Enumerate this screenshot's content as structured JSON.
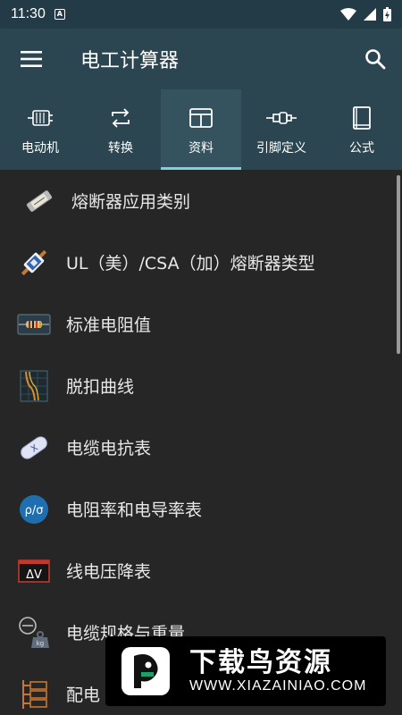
{
  "status_bar": {
    "time": "11:30",
    "notification_badge": "A",
    "icons": [
      "wifi-icon",
      "signal-icon",
      "battery-charging-icon"
    ]
  },
  "app_bar": {
    "title": "电工计算器",
    "menu_icon": "hamburger-menu-icon",
    "search_icon": "search-icon"
  },
  "tabs": [
    {
      "label": "电动机",
      "icon": "motor-icon",
      "active": false
    },
    {
      "label": "转换",
      "icon": "convert-icon",
      "active": false
    },
    {
      "label": "资料",
      "icon": "table-icon",
      "active": true
    },
    {
      "label": "引脚定义",
      "icon": "connector-icon",
      "active": false
    },
    {
      "label": "公式",
      "icon": "book-icon",
      "active": false
    }
  ],
  "list": {
    "items": [
      {
        "label": "熔断器应用类别",
        "icon": "fuse-icon"
      },
      {
        "label": "UL（美）/CSA（加）熔断器类型",
        "icon": "ul-fuse-icon"
      },
      {
        "label": "标准电阻值",
        "icon": "resistor-icon"
      },
      {
        "label": "脱扣曲线",
        "icon": "trip-curve-icon"
      },
      {
        "label": "电缆电抗表",
        "icon": "cable-reactance-icon"
      },
      {
        "label": "电阻率和电导率表",
        "icon": "resistivity-icon",
        "icon_text": "ρ/σ"
      },
      {
        "label": "线电压降表",
        "icon": "voltage-drop-icon",
        "icon_text": "ΔV"
      },
      {
        "label": "电缆规格与重量",
        "icon": "cable-weight-icon"
      },
      {
        "label": "配电",
        "icon": "distribution-icon"
      }
    ]
  },
  "watermark": {
    "title": "下载鸟资源",
    "url": "WWW.XIAZAINIAO.COM"
  },
  "colors": {
    "header": "#2b4651",
    "status_bar": "#233b47",
    "background": "#262626",
    "tab_indicator": "#7fd1df"
  }
}
